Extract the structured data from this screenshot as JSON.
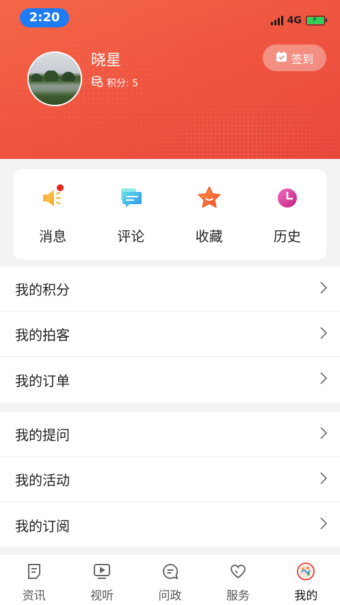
{
  "status_bar": {
    "time": "2:20",
    "network": "4G"
  },
  "profile": {
    "username": "晓星",
    "points_label": "积分: 5",
    "checkin_label": "签到"
  },
  "quick_actions": [
    {
      "label": "消息",
      "icon": "megaphone-icon",
      "has_badge": true
    },
    {
      "label": "评论",
      "icon": "comment-icon",
      "has_badge": false
    },
    {
      "label": "收藏",
      "icon": "star-icon",
      "has_badge": false
    },
    {
      "label": "历史",
      "icon": "clock-icon",
      "has_badge": false
    }
  ],
  "menu_group_1": [
    {
      "label": "我的积分"
    },
    {
      "label": "我的拍客"
    },
    {
      "label": "我的订单"
    }
  ],
  "menu_group_2": [
    {
      "label": "我的提问"
    },
    {
      "label": "我的活动"
    },
    {
      "label": "我的订阅"
    }
  ],
  "tabbar": [
    {
      "label": "资讯",
      "icon": "news-icon",
      "active": false
    },
    {
      "label": "视听",
      "icon": "video-icon",
      "active": false
    },
    {
      "label": "问政",
      "icon": "chat-icon",
      "active": false
    },
    {
      "label": "服务",
      "icon": "heart-icon",
      "active": false
    },
    {
      "label": "我的",
      "icon": "profile-logo-icon",
      "active": true
    }
  ],
  "colors": {
    "header_gradient_start": "#f46747",
    "header_gradient_end": "#e8473b",
    "time_pill": "#1f7bf3",
    "badge_red": "#e8241c",
    "battery_green": "#2fd158"
  }
}
